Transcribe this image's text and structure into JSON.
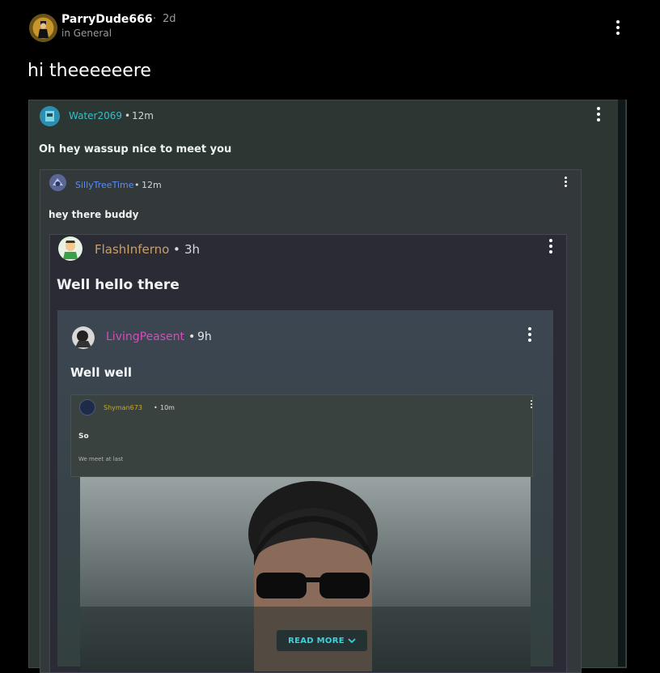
{
  "post": {
    "author": "ParryDude666",
    "separator": "·",
    "time": "2d",
    "community": "in General",
    "body": "hi theeeeeere"
  },
  "embedded": {
    "comments": [
      {
        "author": "Water2069",
        "separator": "•",
        "time": "12m",
        "text": "Oh hey wassup nice to meet you",
        "name_color": "#2fbfc8"
      },
      {
        "author": "SillyTreeTime",
        "separator": "•",
        "time": "12m",
        "text": "hey there buddy",
        "name_color": "#5b8cf0"
      },
      {
        "author": "FlashInferno",
        "separator": "•",
        "time": "3h",
        "text": "Well hello there",
        "name_color": "#c7a06a"
      },
      {
        "author": "LivingPeasent",
        "separator": "•",
        "time": "9h",
        "text": "Well well",
        "name_color": "#d04fb8"
      },
      {
        "author": "Shyman673",
        "separator": "•",
        "time": "10m",
        "text": "So",
        "subtext": "We meet at last",
        "name_color": "#c9a82b"
      }
    ],
    "read_more": "READ MORE"
  },
  "icons": {
    "menu": "more-vertical-icon",
    "chevron": "chevron-down-icon"
  },
  "colors": {
    "background": "#000000",
    "accent": "#3dd2da"
  }
}
